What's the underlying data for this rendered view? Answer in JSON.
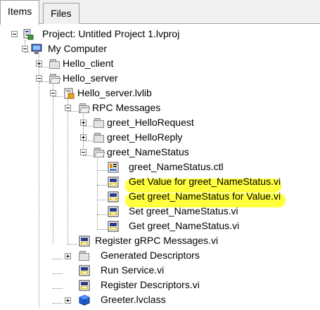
{
  "tabs": [
    {
      "label": "Items",
      "active": true
    },
    {
      "label": "Files",
      "active": false
    }
  ],
  "tree": [
    {
      "label": "Project: Untitled Project 1.lvproj",
      "icon": "project-icon",
      "expander": "minus"
    },
    {
      "label": "My Computer",
      "icon": "computer-icon",
      "expander": "minus"
    },
    {
      "label": "Hello_client",
      "icon": "folder-icon",
      "expander": "plus"
    },
    {
      "label": "Hello_server",
      "icon": "folder-open-icon",
      "expander": "minus"
    },
    {
      "label": "Hello_server.lvlib",
      "icon": "library-icon",
      "expander": "minus"
    },
    {
      "label": "RPC Messages",
      "icon": "folder-open-icon",
      "expander": "minus"
    },
    {
      "label": "greet_HelloRequest",
      "icon": "folder-icon",
      "expander": "plus"
    },
    {
      "label": "greet_HelloReply",
      "icon": "folder-icon",
      "expander": "plus"
    },
    {
      "label": "greet_NameStatus",
      "icon": "folder-open-icon",
      "expander": "minus"
    },
    {
      "label": "greet_NameStatus.ctl",
      "icon": "control-icon",
      "expander": ""
    },
    {
      "label": "Get Value for greet_NameStatus.vi",
      "icon": "vi-icon",
      "expander": "",
      "highlighted": true
    },
    {
      "label": "Get greet_NameStatus for Value.vi",
      "icon": "vi-icon",
      "expander": "",
      "highlighted": true
    },
    {
      "label": "Set greet_NameStatus.vi",
      "icon": "vi-icon",
      "expander": ""
    },
    {
      "label": "Get greet_NameStatus.vi",
      "icon": "vi-icon",
      "expander": ""
    },
    {
      "label": "Register gRPC Messages.vi",
      "icon": "vi-icon",
      "expander": ""
    },
    {
      "label": "Generated Descriptors",
      "icon": "folder-icon",
      "expander": "plus"
    },
    {
      "label": "Run Service.vi",
      "icon": "vi-icon",
      "expander": ""
    },
    {
      "label": "Register Descriptors.vi",
      "icon": "vi-icon",
      "expander": ""
    },
    {
      "label": "Greeter.lvclass",
      "icon": "class-icon",
      "expander": "plus"
    }
  ],
  "colors": {
    "highlight": "#ffff33",
    "folder": "#e3e3e3",
    "class_cube": "#1f5fd1"
  }
}
